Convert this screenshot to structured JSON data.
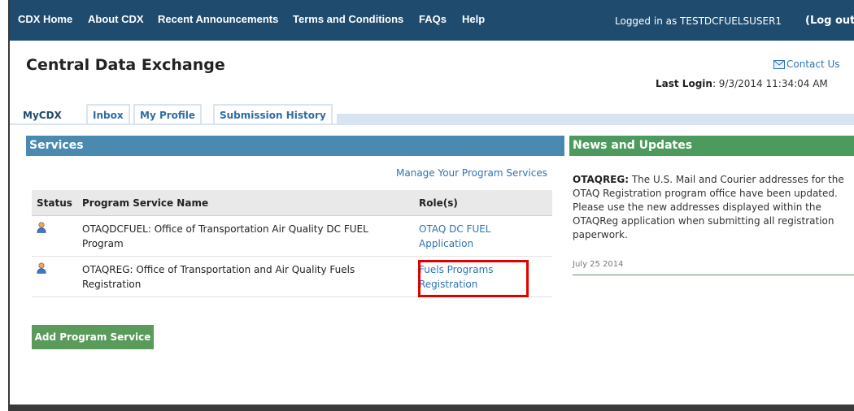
{
  "nav": {
    "items": [
      "CDX Home",
      "About CDX",
      "Recent Announcements",
      "Terms and Conditions",
      "FAQs",
      "Help"
    ],
    "login_text": "Logged in as TESTDCFUELSUSER1",
    "logout_label": "(Log out)"
  },
  "header": {
    "title": "Central Data Exchange",
    "contact_label": "Contact Us",
    "last_login_label": "Last Login",
    "last_login_value": ": 9/3/2014 11:34:04 AM"
  },
  "tabs": [
    "MyCDX",
    "Inbox",
    "My Profile",
    "Submission History"
  ],
  "services": {
    "header": "Services",
    "manage_link": "Manage Your Program Services",
    "columns": [
      "Status",
      "Program Service Name",
      "Role(s)"
    ],
    "rows": [
      {
        "name": "OTAQDCFUEL: Office of Transportation Air Quality DC FUEL Program",
        "role": "OTAQ DC FUEL Application",
        "status_icon": "user-icon"
      },
      {
        "name": "OTAQREG: Office of Transportation and Air Quality Fuels Registration",
        "role": "Fuels Programs Registration",
        "status_icon": "user-icon"
      }
    ],
    "add_button": "Add Program Service"
  },
  "news": {
    "header": "News and Updates",
    "item_title": "OTAQREG:",
    "item_text": " The U.S. Mail and Courier addresses for the OTAQ Registration program office have been updated. Please use the new addresses displayed within the OTAQReg application when submitting all registration paperwork.",
    "item_date": "July 25 2014"
  },
  "colors": {
    "nav_bg": "#1f4b6e",
    "services_header": "#4a89b0",
    "news_header": "#4d9a5e",
    "add_button": "#5a9a5a",
    "link": "#2e74b5",
    "highlight": "#e00000"
  }
}
